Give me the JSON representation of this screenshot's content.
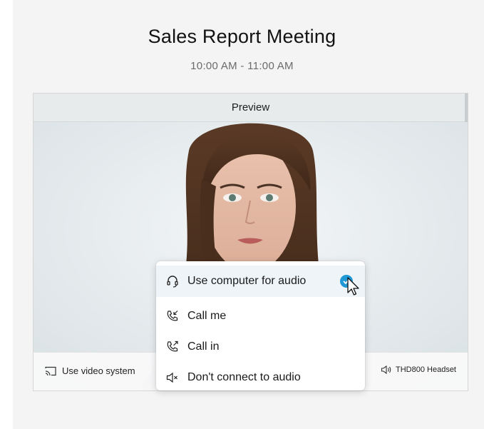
{
  "meeting": {
    "title": "Sales Report Meeting",
    "time": "10:00 AM - 11:00 AM"
  },
  "preview": {
    "header_label": "Preview",
    "video_system_label": "Use video system",
    "audio_device_label": "THD800 Headset"
  },
  "audio_menu": {
    "items": [
      {
        "label": "Use computer for audio",
        "icon": "headset-icon",
        "selected": true
      },
      {
        "label": "Call me",
        "icon": "call-me-icon",
        "selected": false
      },
      {
        "label": "Call in",
        "icon": "call-in-icon",
        "selected": false
      },
      {
        "label": "Don't connect to audio",
        "icon": "speaker-muted-icon",
        "selected": false
      }
    ]
  },
  "colors": {
    "accent": "#1f98d6",
    "panel_background": "#f4f4f4"
  }
}
